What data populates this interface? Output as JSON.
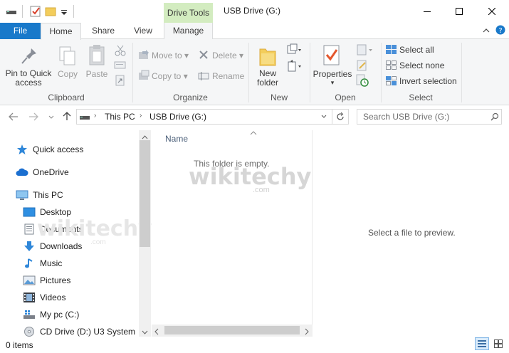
{
  "window": {
    "title": "USB Drive (G:)",
    "context_tab_group": "Drive Tools"
  },
  "tabs": [
    {
      "label": "File"
    },
    {
      "label": "Home"
    },
    {
      "label": "Share"
    },
    {
      "label": "View"
    },
    {
      "label": "Manage"
    }
  ],
  "ribbon": {
    "clipboard": {
      "label": "Clipboard",
      "pin_line1": "Pin to Quick",
      "pin_line2": "access",
      "copy": "Copy",
      "paste": "Paste"
    },
    "organize": {
      "label": "Organize",
      "move_to": "Move to",
      "copy_to": "Copy to",
      "delete": "Delete",
      "rename": "Rename"
    },
    "new": {
      "label": "New",
      "new_folder_line1": "New",
      "new_folder_line2": "folder"
    },
    "open": {
      "label": "Open",
      "properties": "Properties"
    },
    "select": {
      "label": "Select",
      "select_all": "Select all",
      "select_none": "Select none",
      "invert_selection": "Invert selection"
    }
  },
  "address": {
    "crumbs": [
      "This PC",
      "USB Drive (G:)"
    ],
    "search_placeholder": "Search USB Drive (G:)"
  },
  "nav": {
    "quick_access": "Quick access",
    "onedrive": "OneDrive",
    "this_pc": "This PC",
    "items": [
      "Desktop",
      "Documents",
      "Downloads",
      "Music",
      "Pictures",
      "Videos",
      "My pc (C:)",
      "CD Drive (D:) U3 System"
    ]
  },
  "content": {
    "column_name": "Name",
    "empty_message": "This folder is empty.",
    "preview_message": "Select a file to preview."
  },
  "watermark": {
    "text": "wikitechy",
    "domain": ".com"
  },
  "status": {
    "items": "0 items"
  },
  "colors": {
    "accent": "#1979ca",
    "drive_tools": "#d3ecc0"
  }
}
